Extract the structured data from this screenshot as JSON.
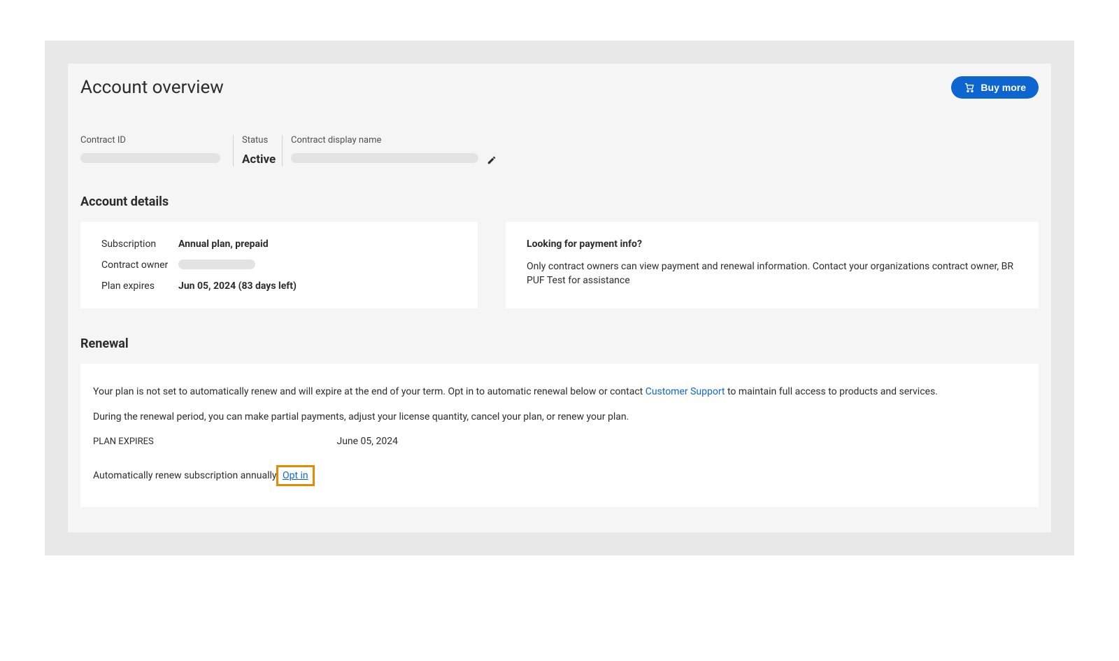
{
  "header": {
    "title": "Account overview",
    "buy_more_label": "Buy more"
  },
  "contract": {
    "id_label": "Contract ID",
    "status_label": "Status",
    "status_value": "Active",
    "display_name_label": "Contract display name"
  },
  "details": {
    "heading": "Account details",
    "subscription_label": "Subscription",
    "subscription_value": "Annual plan, prepaid",
    "owner_label": "Contract owner",
    "expires_label": "Plan expires",
    "expires_value": "Jun 05, 2024 (83 days left)"
  },
  "payment_info": {
    "heading": "Looking for payment info?",
    "body": "Only contract owners can view payment and renewal information. Contact your organizations contract owner, BR PUF Test for assistance"
  },
  "renewal": {
    "heading": "Renewal",
    "line1_a": "Your plan is not set to automatically renew and will expire at the end of your term. Opt in to automatic renewal below or contact ",
    "line1_link": "Customer Support",
    "line1_b": " to maintain full access to products and services.",
    "line2": "During the renewal period, you can make partial payments, adjust your license quantity, cancel your plan, or renew your plan.",
    "plan_expires_label": "PLAN EXPIRES",
    "plan_expires_value": "June 05, 2024",
    "auto_renew_label": "Automatically renew subscription annually",
    "opt_in_label": "Opt in"
  }
}
